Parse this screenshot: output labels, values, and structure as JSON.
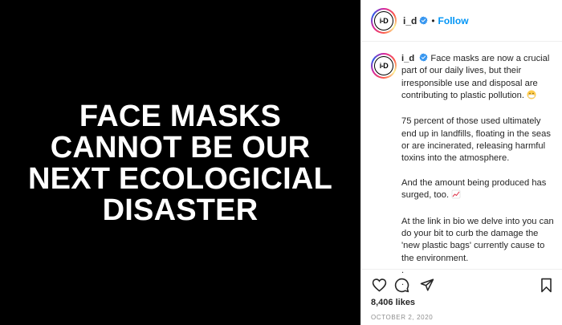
{
  "media": {
    "headline_lines": [
      "FACE MASKS",
      "CANNOT BE OUR",
      "NEXT ECOLOGICIAL",
      "DISASTER"
    ]
  },
  "header": {
    "avatar_text": "i-D",
    "username": "i_d",
    "separator": "•",
    "follow_label": "Follow"
  },
  "caption": {
    "username": "i_d",
    "paragraph1": "Face masks are now a crucial part of our daily lives, but their irresponsible use and disposal are contributing to plastic pollution.",
    "paragraph1_emoji": "mask-face-emoji",
    "paragraph2": "75 percent of those used ultimately end up in landfills, floating in the seas or are incinerated, releasing harmful toxins into the atmosphere.",
    "paragraph3": "And the amount being produced has surged, too.",
    "paragraph3_emoji": "chart-increasing-emoji",
    "paragraph4": "At the link in bio we delve into you can do your bit to curb the damage the 'new plastic bags' currently cause to the environment.",
    "trail1": ".",
    "trail2": "."
  },
  "actions": {
    "icons": [
      "heart-icon",
      "comment-icon",
      "share-icon",
      "bookmark-icon"
    ]
  },
  "likes": "8,406 likes",
  "date": "OCTOBER 2, 2020",
  "colors": {
    "follow_blue": "#0095f6",
    "verified_blue": "#3897f0",
    "media_bg": "#000000",
    "meta_gray": "#8e8e8e"
  }
}
